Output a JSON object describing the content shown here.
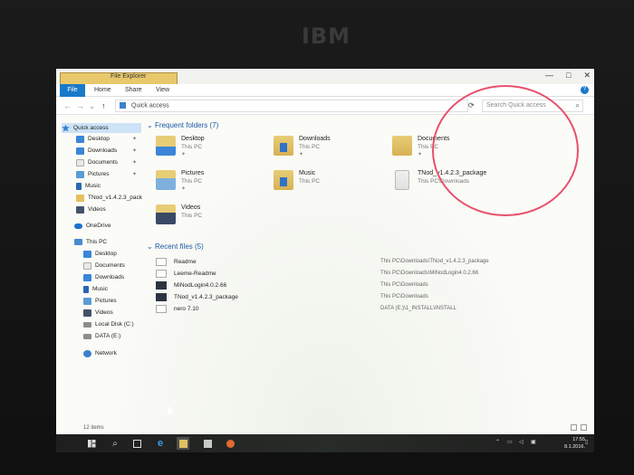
{
  "brand": "IBM",
  "window": {
    "title": "File Explorer",
    "controls": {
      "minimize": "—",
      "maximize": "□",
      "close": "✕"
    }
  },
  "ribbon": {
    "tabs": [
      "File",
      "Home",
      "Share",
      "View"
    ],
    "help": "?"
  },
  "address": {
    "back": "←",
    "forward": "→",
    "up": "↑",
    "path": "Quick access",
    "dropdown": "⌄",
    "refresh": "⟳",
    "search_placeholder": "Search Quick access"
  },
  "sidebar": {
    "quick_access": "Quick access",
    "quick_items": [
      {
        "label": "Desktop",
        "icon": "desktop-icon"
      },
      {
        "label": "Downloads",
        "icon": "downloads-icon"
      },
      {
        "label": "Documents",
        "icon": "documents-icon"
      },
      {
        "label": "Pictures",
        "icon": "pictures-icon"
      },
      {
        "label": "Music",
        "icon": "music-icon"
      },
      {
        "label": "TNod_v1.4.2.3_pack",
        "icon": "folder-icon"
      },
      {
        "label": "Videos",
        "icon": "videos-icon"
      }
    ],
    "onedrive": "OneDrive",
    "this_pc": "This PC",
    "pc_items": [
      "Desktop",
      "Documents",
      "Downloads",
      "Music",
      "Pictures",
      "Videos",
      "Local Disk (C:)",
      "DATA (E:)"
    ],
    "network": "Network"
  },
  "frequent": {
    "header": "Frequent folders (7)",
    "folders": [
      {
        "name": "Desktop",
        "sub": "This PC"
      },
      {
        "name": "Downloads",
        "sub": "This PC"
      },
      {
        "name": "Documents",
        "sub": "This PC"
      },
      {
        "name": "Pictures",
        "sub": "This PC"
      },
      {
        "name": "Music",
        "sub": "This PC"
      },
      {
        "name": "TNod_v1.4.2.3_package",
        "sub": "This PC\\Downloads"
      },
      {
        "name": "Videos",
        "sub": "This PC"
      }
    ]
  },
  "recent": {
    "header": "Recent files (5)",
    "files": [
      {
        "name": "Readme",
        "path": "This PC\\Downloads\\TNod_v1.4.2.3_package"
      },
      {
        "name": "Leeme-Readme",
        "path": "This PC\\Downloads\\MiNodLogin4.0.2.66"
      },
      {
        "name": "MiNodLogin4.0.2.66",
        "path": "This PC\\Downloads"
      },
      {
        "name": "TNod_v1.4.2.3_package",
        "path": "This PC\\Downloads"
      },
      {
        "name": "nero 7.10",
        "path": "DATA (E:)\\1_INSTALL\\INSTALL"
      }
    ]
  },
  "status": {
    "items": "12 items"
  },
  "taskbar": {
    "clock_time": "17:55",
    "clock_date": "8.1.2016."
  },
  "colors": {
    "accent": "#1979ca",
    "annotation_circle": "#e8506e"
  }
}
